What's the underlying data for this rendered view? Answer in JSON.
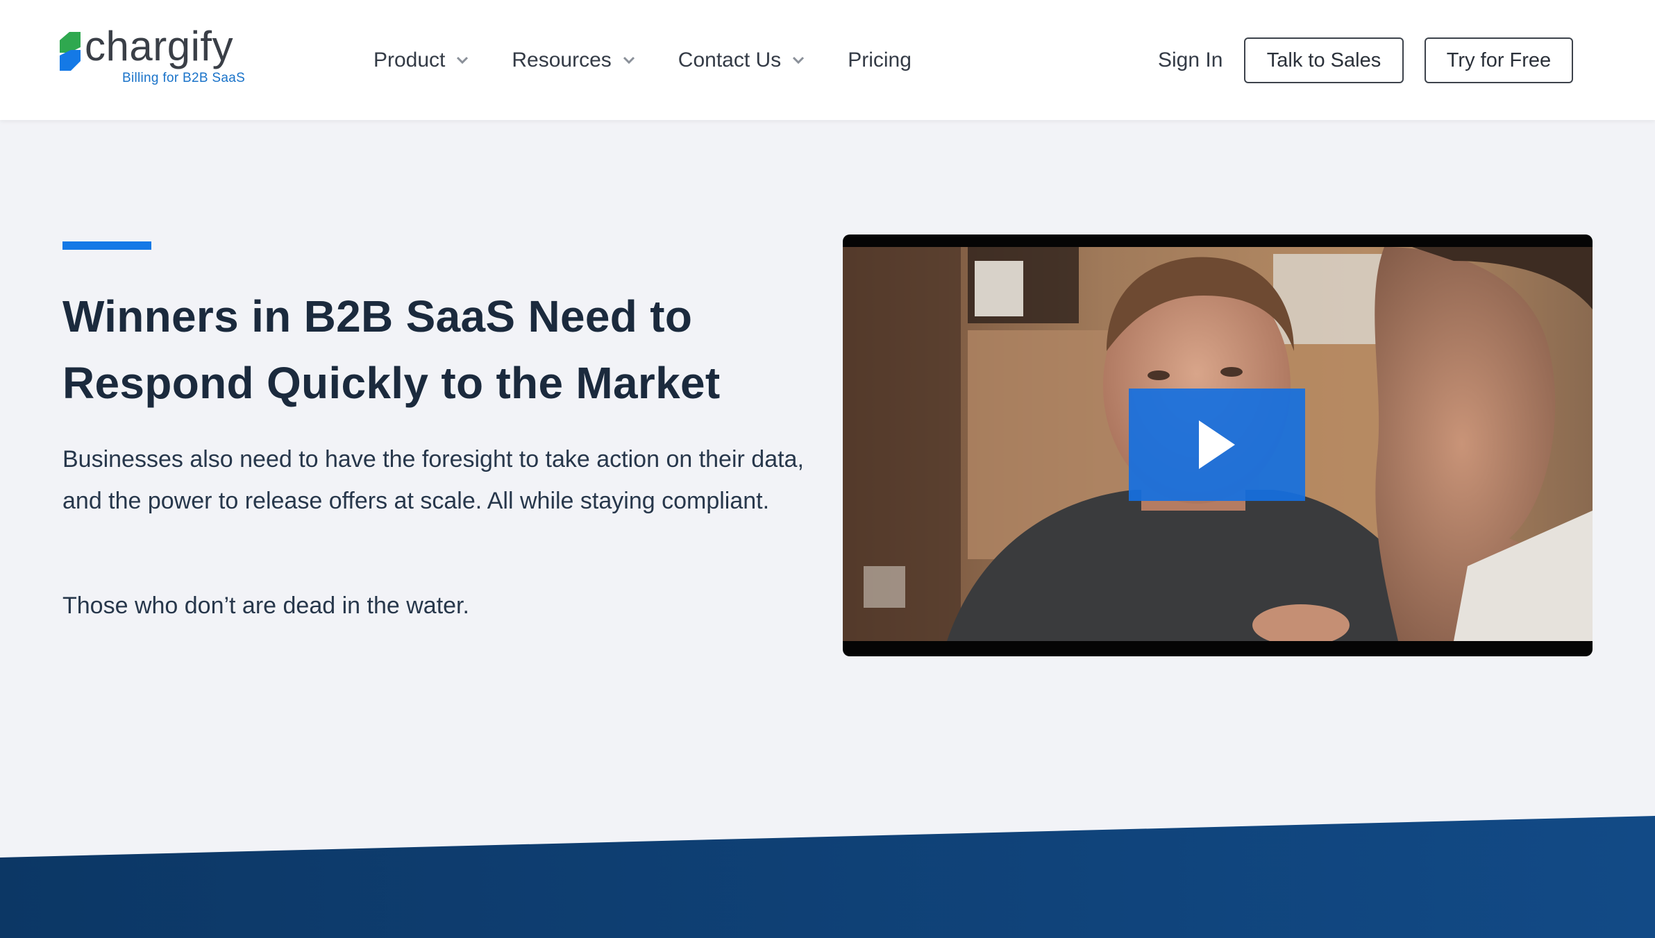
{
  "brand": {
    "name": "chargify",
    "tagline": "Billing for B2B SaaS",
    "logo_icon": "chargify-logo-icon",
    "colors": {
      "green": "#2fa84f",
      "blue": "#1479e6"
    }
  },
  "nav": {
    "items": [
      {
        "label": "Product",
        "has_dropdown": true
      },
      {
        "label": "Resources",
        "has_dropdown": true
      },
      {
        "label": "Contact Us",
        "has_dropdown": true
      },
      {
        "label": "Pricing",
        "has_dropdown": false
      }
    ],
    "sign_in": "Sign In",
    "talk_to_sales": "Talk to Sales",
    "try_for_free": "Try for Free"
  },
  "hero": {
    "title": "Winners in B2B SaaS Need to Respond Quickly to the Market",
    "paragraph1": "Businesses also need to have the foresight to take action on their data, and the power to release offers at scale. All while staying compliant.",
    "paragraph2": "Those who don’t are dead in the water."
  },
  "video": {
    "play_icon": "play-icon",
    "accent": "#1670e0"
  },
  "colors": {
    "page_bg": "#f2f3f7",
    "heading": "#1b2a3d",
    "band": "#0f3f72"
  }
}
